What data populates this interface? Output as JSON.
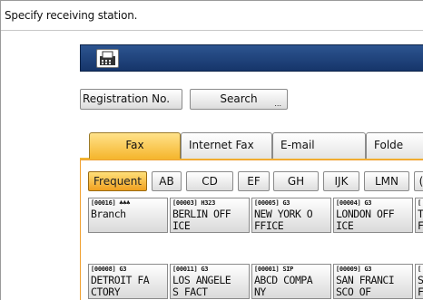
{
  "prompt": "Specify receiving station.",
  "buttons": {
    "registration": "Registration No.",
    "search": "Search",
    "search_dots": "..."
  },
  "tabs": [
    "Fax",
    "Internet Fax",
    "E-mail",
    "Folde"
  ],
  "quick_tabs": [
    "Frequent",
    "AB",
    "CD",
    "EF",
    "GH",
    "IJK",
    "LMN",
    "("
  ],
  "entries": [
    {
      "code": "[00016]",
      "type": "♣♣♣",
      "name": "Branch"
    },
    {
      "code": "[00003]",
      "type": "H323",
      "name": "BERLIN OFF\nICE"
    },
    {
      "code": "[00005]",
      "type": "G3",
      "name": "NEW YORK O\nFFICE"
    },
    {
      "code": "[00004]",
      "type": "G3",
      "name": "LONDON OFF\nICE"
    },
    {
      "code": "[",
      "type": "",
      "name": "T\nF"
    },
    {
      "code": "[00008]",
      "type": "G3",
      "name": "DETROIT FA\nCTORY"
    },
    {
      "code": "[00011]",
      "type": "G3",
      "name": "LOS ANGELE\nS FACT"
    },
    {
      "code": "[00001]",
      "type": "SIP",
      "name": "ABCD COMPA\nNY"
    },
    {
      "code": "[00009]",
      "type": "G3",
      "name": "SAN FRANCI\nSCO OF"
    },
    {
      "code": "[",
      "type": "",
      "name": "S\nF"
    }
  ]
}
